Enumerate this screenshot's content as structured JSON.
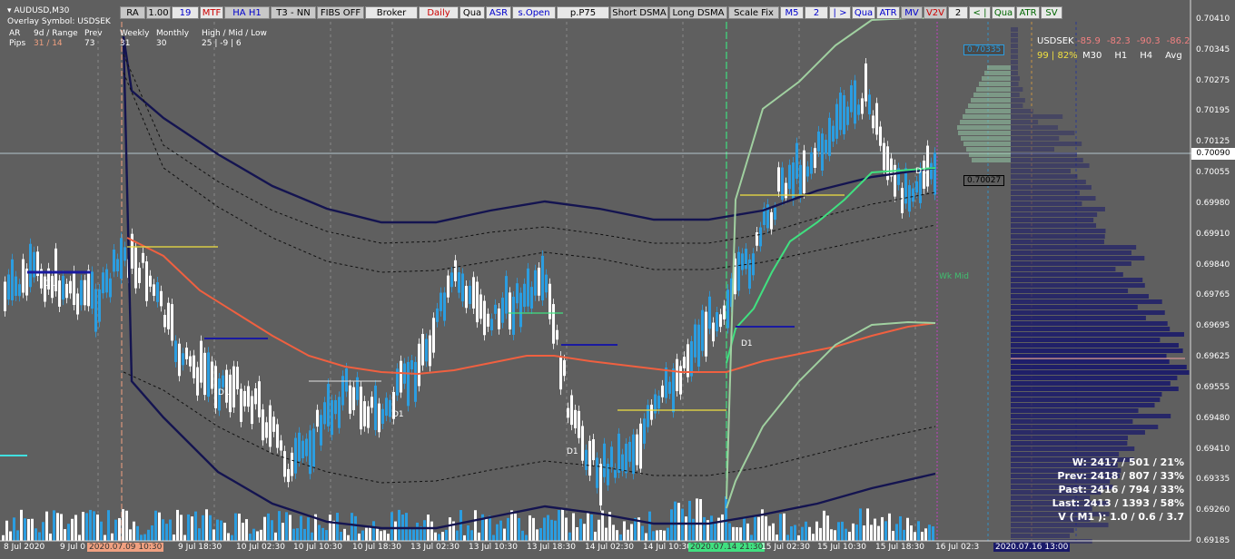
{
  "window": {
    "title": "AUDUSD,M30",
    "overlay_symbol": "Overlay Symbol: USDSEK"
  },
  "toolbar": [
    {
      "label": "RA",
      "color": "#000000",
      "bg": "#c8c8c8"
    },
    {
      "label": "1.00",
      "color": "#000000",
      "bg": "#c8c8c8"
    },
    {
      "label": "19",
      "color": "#0000cc",
      "bg": "#e8e8e8"
    },
    {
      "label": "MTF",
      "color": "#cc0000",
      "bg": "#e8e8e8"
    },
    {
      "label": "HA H1",
      "color": "#0000cc",
      "bg": "#c8c8c8"
    },
    {
      "label": "T3 - NN",
      "color": "#000000",
      "bg": "#c8c8c8"
    },
    {
      "label": "FIBS OFF",
      "color": "#000000",
      "bg": "#c8c8c8"
    },
    {
      "label": "Broker",
      "color": "#000000",
      "bg": "#e8e8e8"
    },
    {
      "label": "Daily",
      "color": "#cc0000",
      "bg": "#e8e8e8"
    },
    {
      "label": "Qua",
      "color": "#000000",
      "bg": "#e8e8e8"
    },
    {
      "label": "ASR",
      "color": "#0000cc",
      "bg": "#e8e8e8"
    },
    {
      "label": "s.Open",
      "color": "#0000cc",
      "bg": "#e8e8e8"
    },
    {
      "label": "p.P75",
      "color": "#000000",
      "bg": "#e8e8e8"
    },
    {
      "label": "Short DSMA",
      "color": "#000000",
      "bg": "#c8c8c8"
    },
    {
      "label": "Long DSMA",
      "color": "#000000",
      "bg": "#c8c8c8"
    },
    {
      "label": "Scale Fix",
      "color": "#000000",
      "bg": "#c8c8c8"
    },
    {
      "label": "M5",
      "color": "#0000cc",
      "bg": "#e8e8e8"
    },
    {
      "label": "2",
      "color": "#0000cc",
      "bg": "#e8e8e8"
    },
    {
      "label": "| >",
      "color": "#0000cc",
      "bg": "#e8e8e8"
    },
    {
      "label": "Qua",
      "color": "#0000cc",
      "bg": "#e8e8e8"
    },
    {
      "label": "ATR",
      "color": "#0000cc",
      "bg": "#e8e8e8"
    },
    {
      "label": "MV",
      "color": "#0000cc",
      "bg": "#c8c8c8"
    },
    {
      "label": "V2V",
      "color": "#cc0000",
      "bg": "#c8c8c8"
    },
    {
      "label": "2",
      "color": "#000000",
      "bg": "#e8e8e8"
    },
    {
      "label": "< |",
      "color": "#006600",
      "bg": "#e8e8e8"
    },
    {
      "label": "Qua",
      "color": "#006600",
      "bg": "#e8e8e8"
    },
    {
      "label": "ATR",
      "color": "#006600",
      "bg": "#e8e8e8"
    },
    {
      "label": "SV",
      "color": "#006600",
      "bg": "#e8e8e8"
    }
  ],
  "stats_table": {
    "headers": [
      "AR",
      "9d / Range",
      "Prev",
      "Weekly",
      "Monthly",
      "High / Mid / Low"
    ],
    "row_label": "Pips",
    "values": [
      "31 / 14",
      "73",
      "31",
      "30",
      "25 | -9 | 6"
    ]
  },
  "overlay_panel": {
    "symbol": "USDSEK",
    "values": [
      "-85.9",
      "-82.3",
      "-90.3",
      "-86.2"
    ],
    "ratio": "99 | 82%",
    "timeframes": [
      "M30",
      "H1",
      "H4",
      "Avg"
    ]
  },
  "volume_stats": [
    "W: 2417 / 501 / 21%",
    "Prev: 2418 / 807 / 33%",
    "Past: 2416 / 794 / 33%",
    "Last: 2413 / 1393 / 58%",
    "V ( M1 ): 1.0 / 0.6 / 3.7"
  ],
  "price_axis": [
    "0.70410",
    "0.70345",
    "0.70275",
    "0.70195",
    "0.70125",
    "0.70055",
    "0.69980",
    "0.69910",
    "0.69840",
    "0.69765",
    "0.69695",
    "0.69625",
    "0.69555",
    "0.69480",
    "0.69410",
    "0.69335",
    "0.69260",
    "0.69185"
  ],
  "current_price": "0.70090",
  "price_tags": {
    "upper": "0.70335",
    "mid": "0.70027"
  },
  "chart_labels": {
    "d1": "D1",
    "wk_mid": "Wk Mid"
  },
  "time_axis": [
    "8 Jul 2020",
    "9 Jul 0",
    "2020.07.09 10:30",
    "9 Jul 18:30",
    "10 Jul 02:30",
    "10 Jul 10:30",
    "10 Jul 18:30",
    "13 Jul 02:30",
    "13 Jul 10:30",
    "13 Jul 18:30",
    "14 Jul 02:30",
    "14 Jul 10:30",
    "2020.07.14 21:30",
    "15 Jul 02:30",
    "15 Jul 10:30",
    "15 Jul 18:30",
    "16 Jul 02:3",
    "2020.07.16 13:00"
  ],
  "colors": {
    "background": "#5f5f5f",
    "bull": "#2b9de0",
    "bear": "#ffffff",
    "envelope": "#141450",
    "ma_red": "#f06040",
    "ma_green": "#40e080",
    "band_light": "#a0d0a0",
    "profile": "#1a1a6a",
    "highlight_red": "#f0a080",
    "highlight_green": "#40e080",
    "highlight_blue": "#1a1a6a"
  }
}
